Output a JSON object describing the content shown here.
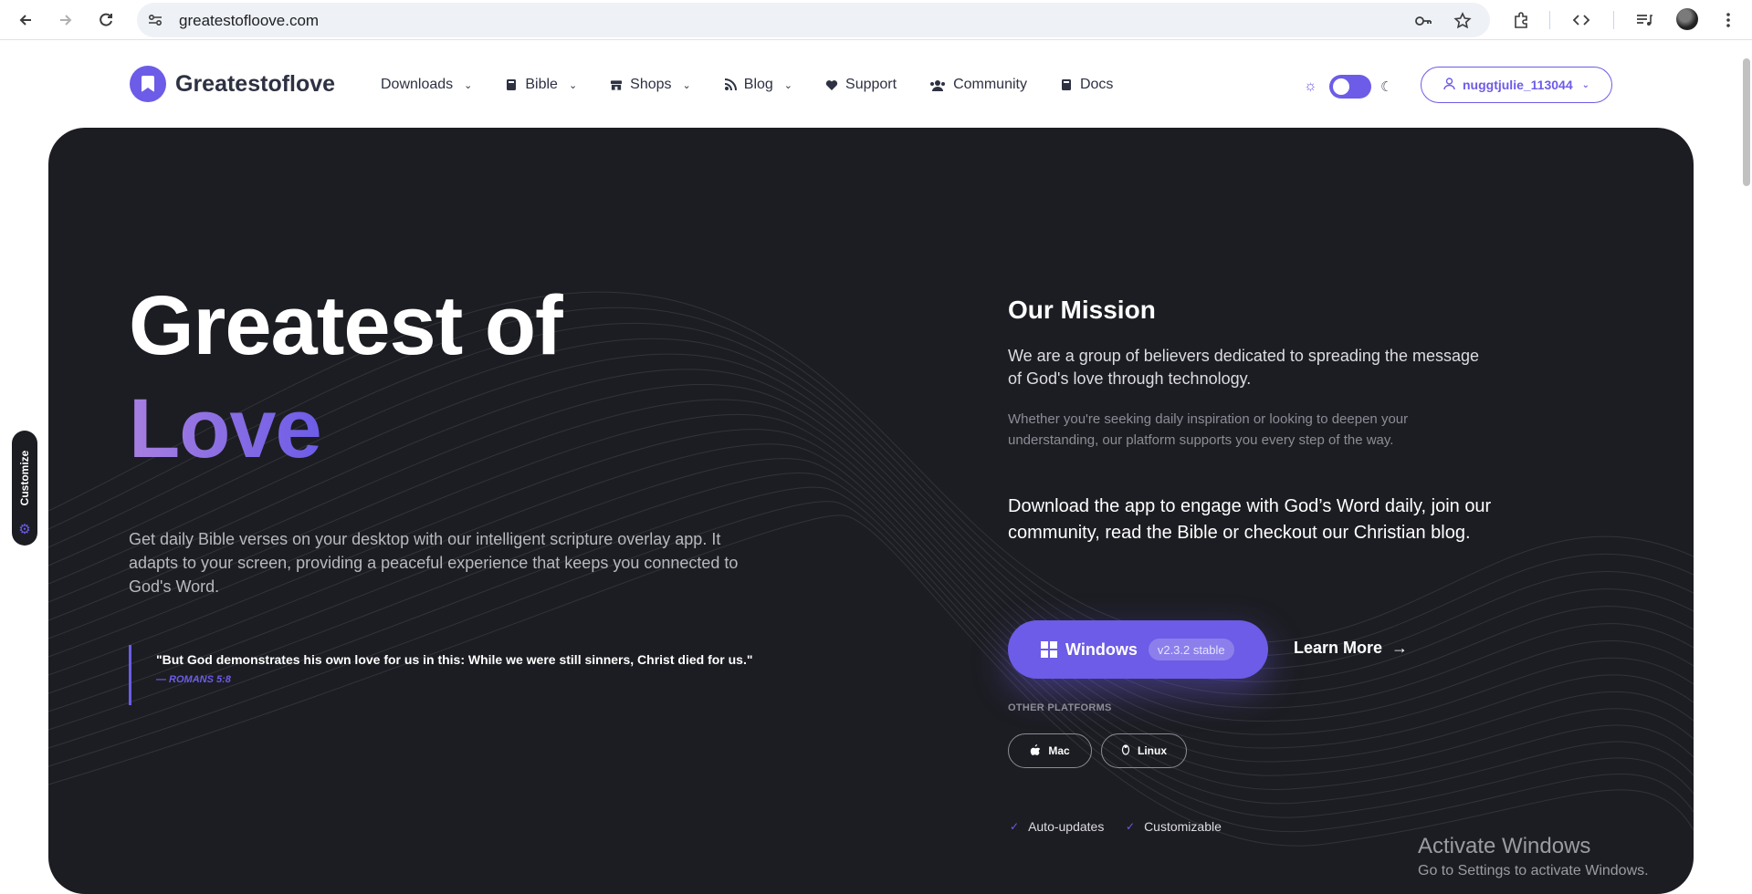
{
  "browser": {
    "url": "greatestofloove.com"
  },
  "header": {
    "brand": "Greatestoflove",
    "nav": [
      {
        "label": "Downloads",
        "icon": "none",
        "dropdown": true
      },
      {
        "label": "Bible",
        "icon": "book-icon",
        "dropdown": true
      },
      {
        "label": "Shops",
        "icon": "store-icon",
        "dropdown": true
      },
      {
        "label": "Blog",
        "icon": "rss-icon",
        "dropdown": true
      },
      {
        "label": "Support",
        "icon": "heart-icon",
        "dropdown": false
      },
      {
        "label": "Community",
        "icon": "users-icon",
        "dropdown": false
      },
      {
        "label": "Docs",
        "icon": "book-icon",
        "dropdown": false
      }
    ],
    "theme_toggle": {
      "state": "on"
    },
    "user": {
      "name": "nuggtjulie_113044"
    }
  },
  "hero": {
    "title_line1": "Greatest of",
    "title_line2": "Love",
    "description": "Get daily Bible verses on your desktop with our intelligent scripture overlay app. It adapts to your screen, providing a peaceful experience that keeps you connected to God's Word.",
    "quote": {
      "text": "\"But God demonstrates his own love for us in this: While we were still sinners, Christ died for us.\"",
      "reference": "— ROMANS 5:8"
    },
    "mission": {
      "title": "Our Mission",
      "paragraph1": "We are a group of believers dedicated to spreading the message of God's love through technology.",
      "paragraph2": "Whether you're seeking daily inspiration or looking to deepen your understanding, our platform supports you every step of the way.",
      "paragraph3": "Download the app to engage with God’s Word daily, join our community, read the Bible or checkout our Christian blog."
    },
    "download": {
      "primary_label": "Windows",
      "version": "v2.3.2 stable",
      "learn_more": "Learn More",
      "other_platforms_label": "OTHER PLATFORMS",
      "platforms": [
        "Mac",
        "Linux"
      ],
      "features": [
        "Auto-updates",
        "Customizable"
      ]
    }
  },
  "customize_tab": {
    "label": "Customize"
  },
  "watermark": {
    "line1": "Activate Windows",
    "line2": "Go to Settings to activate Windows."
  },
  "colors": {
    "accent": "#6c5ce7",
    "hero_bg": "#1c1d22",
    "gradient_start": "#a77fe0"
  }
}
